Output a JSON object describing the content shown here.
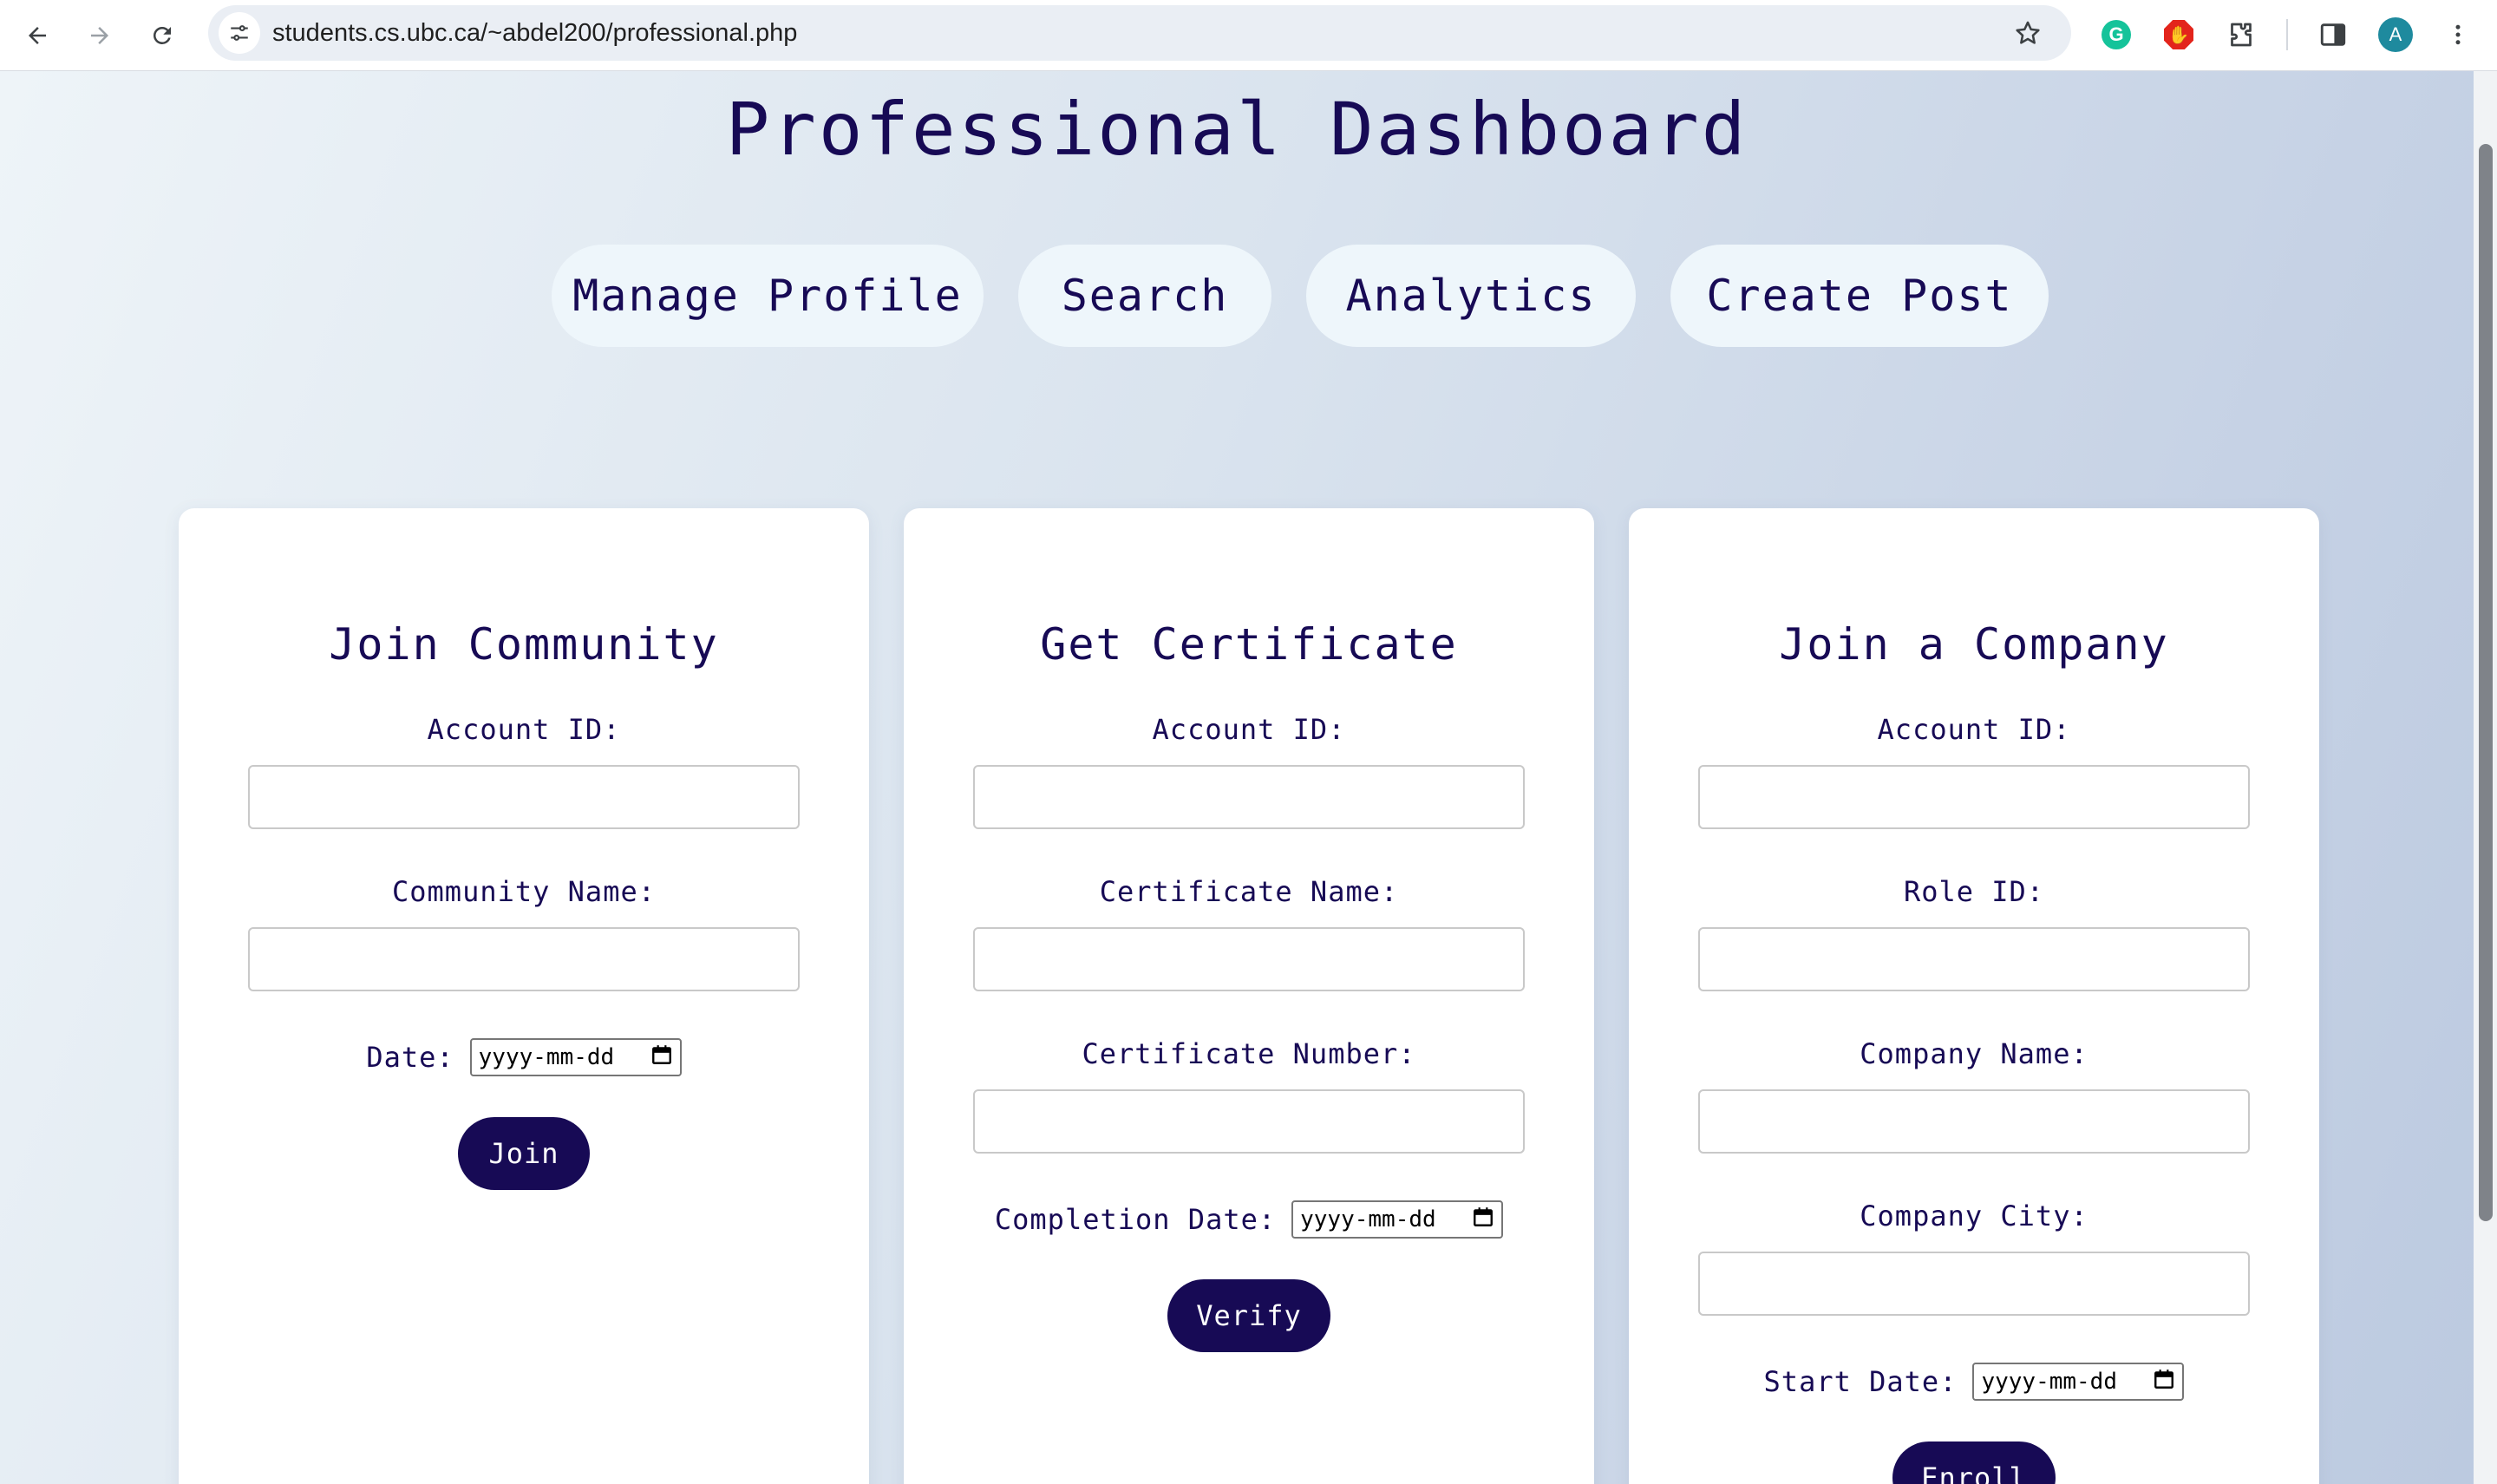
{
  "browser": {
    "url": "students.cs.ubc.ca/~abdel200/professional.php",
    "back_icon": "back-arrow-icon",
    "forward_icon": "forward-arrow-icon",
    "reload_icon": "reload-icon",
    "grammarly_letter": "G",
    "profile_letter": "A"
  },
  "page": {
    "title": "Professional Dashboard",
    "nav": [
      {
        "label": "Manage Profile"
      },
      {
        "label": "Search"
      },
      {
        "label": "Analytics"
      },
      {
        "label": "Create Post"
      }
    ]
  },
  "cards": {
    "community": {
      "title": "Join Community",
      "account_label": "Account ID:",
      "name_label": "Community Name:",
      "date_label": "Date:",
      "date_placeholder": "yyyy-mm-dd",
      "button": "Join"
    },
    "certificate": {
      "title": "Get Certificate",
      "account_label": "Account ID:",
      "name_label": "Certificate Name:",
      "number_label": "Certificate Number:",
      "date_label": "Completion Date:",
      "date_placeholder": "yyyy-mm-dd",
      "button": "Verify"
    },
    "company": {
      "title": "Join a Company",
      "account_label": "Account ID:",
      "role_label": "Role ID:",
      "name_label": "Company Name:",
      "city_label": "Company City:",
      "date_label": "Start Date:",
      "date_placeholder": "yyyy-mm-dd",
      "button": "Enroll"
    }
  },
  "colors": {
    "primary": "#170a55",
    "pill_bg": "#eef6fb",
    "card_bg": "#ffffff"
  }
}
